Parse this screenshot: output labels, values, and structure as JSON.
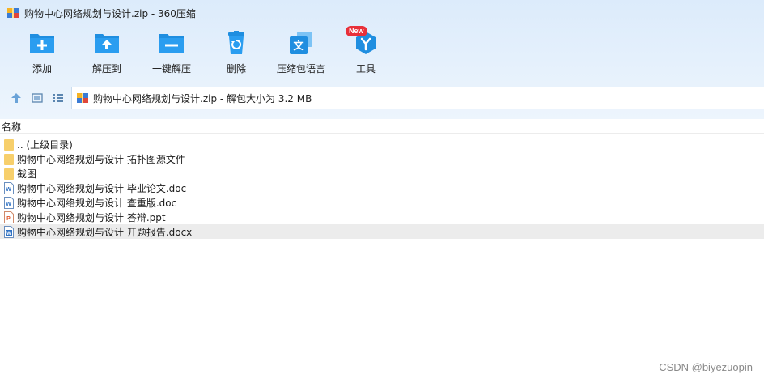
{
  "window": {
    "title": "购物中心网络规划与设计.zip - 360压缩"
  },
  "toolbar": {
    "buttons": [
      {
        "label": "添加",
        "icon": "folder-add-icon"
      },
      {
        "label": "解压到",
        "icon": "folder-extract-icon"
      },
      {
        "label": "一键解压",
        "icon": "folder-one-click-icon"
      },
      {
        "label": "删除",
        "icon": "trash-recycle-icon"
      },
      {
        "label": "压缩包语言",
        "icon": "language-icon"
      },
      {
        "label": "工具",
        "icon": "tools-icon",
        "badge": "New"
      }
    ]
  },
  "nav": {
    "path": "购物中心网络规划与设计.zip - 解包大小为 3.2 MB"
  },
  "columns": {
    "name": "名称"
  },
  "files": [
    {
      "name": ".. (上级目录)",
      "type": "folder"
    },
    {
      "name": "购物中心网络规划与设计 拓扑图源文件",
      "type": "folder"
    },
    {
      "name": "截图",
      "type": "folder"
    },
    {
      "name": "购物中心网络规划与设计 毕业论文.doc",
      "type": "doc"
    },
    {
      "name": "购物中心网络规划与设计 查重版.doc",
      "type": "doc"
    },
    {
      "name": "购物中心网络规划与设计 答辩.ppt",
      "type": "ppt"
    },
    {
      "name": "购物中心网络规划与设计 开题报告.docx",
      "type": "docx"
    }
  ],
  "watermark": "CSDN @biyezuopin",
  "colors": {
    "accent": "#1f8ee0",
    "folder": "#f7cf6b",
    "ppt": "#e2572c",
    "doc": "#2f72c4"
  }
}
